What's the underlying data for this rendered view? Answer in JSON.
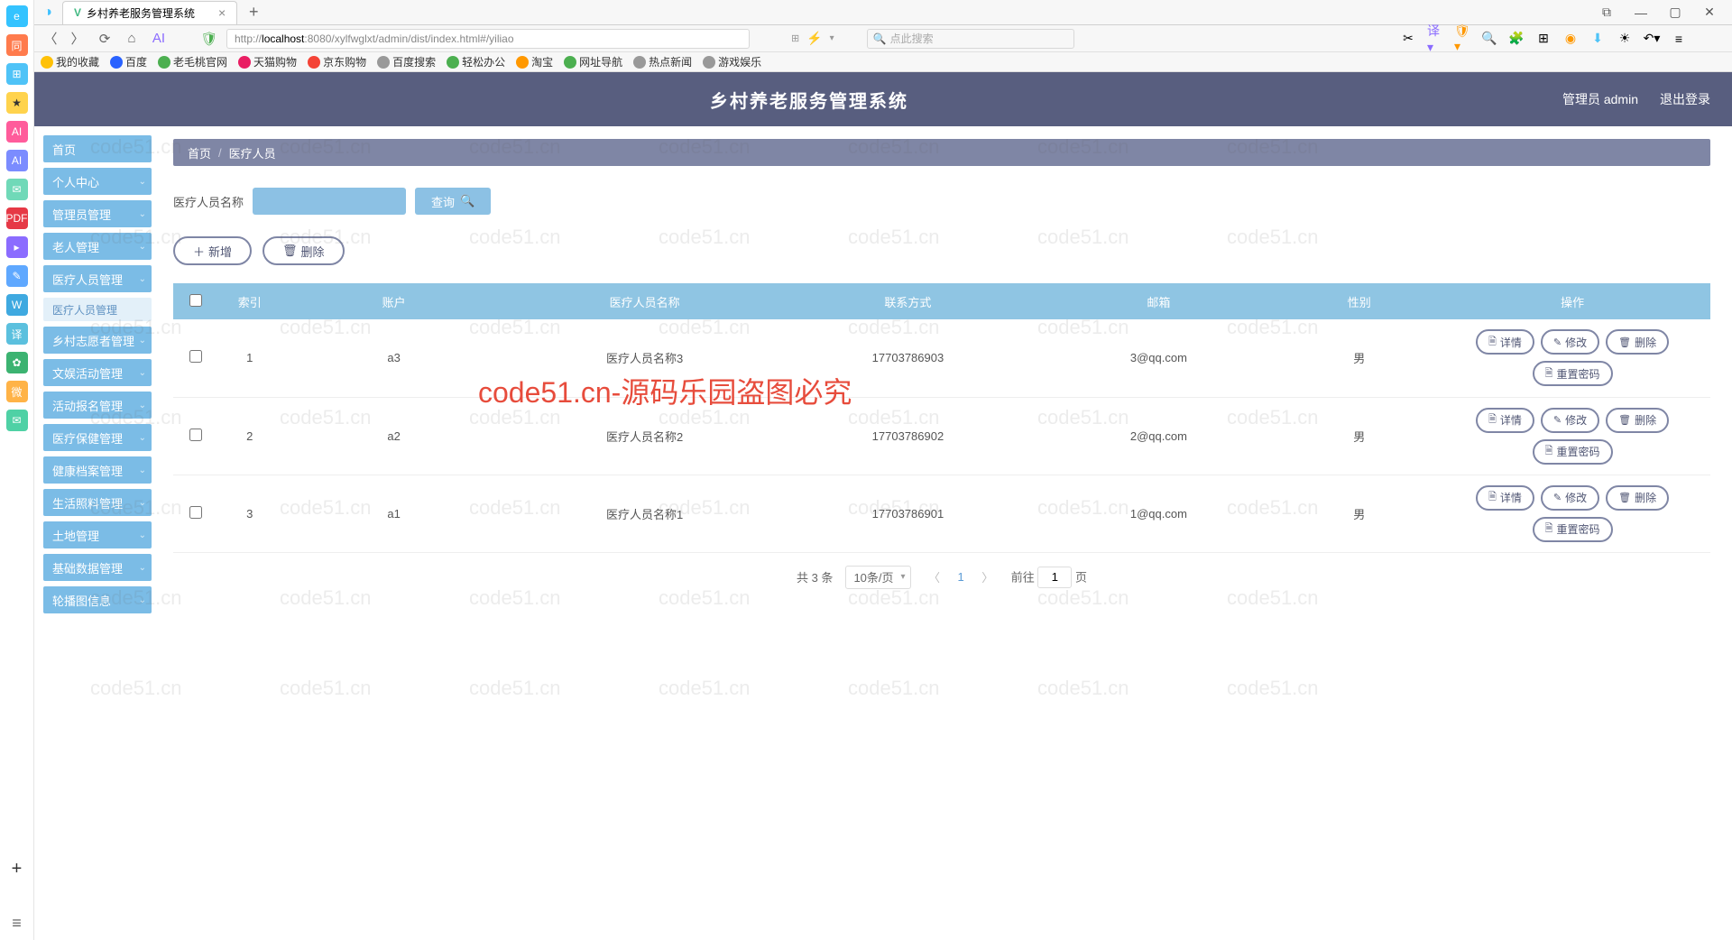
{
  "browser": {
    "tab_title": "乡村养老服务管理系统",
    "url_host": "localhost",
    "url_prefix": "http://",
    "url_port_path": ":8080/xylfwglxt/admin/dist/index.html#/yiliao",
    "search_placeholder": "点此搜索"
  },
  "bookmarks": [
    "我的收藏",
    "百度",
    "老毛桃官网",
    "天猫购物",
    "京东购物",
    "百度搜索",
    "轻松办公",
    "淘宝",
    "网址导航",
    "热点新闻",
    "游戏娱乐"
  ],
  "header": {
    "title": "乡村养老服务管理系统",
    "user_label": "管理员 admin",
    "logout": "退出登录"
  },
  "sidebar": {
    "items": [
      "首页",
      "个人中心",
      "管理员管理",
      "老人管理",
      "医疗人员管理",
      "医疗人员管理",
      "乡村志愿者管理",
      "文娱活动管理",
      "活动报名管理",
      "医疗保健管理",
      "健康档案管理",
      "生活照料管理",
      "土地管理",
      "基础数据管理",
      "轮播图信息"
    ]
  },
  "breadcrumb": {
    "home": "首页",
    "current": "医疗人员"
  },
  "search": {
    "label": "医疗人员名称",
    "btn": "查询"
  },
  "actions": {
    "add": "新增",
    "del": "删除"
  },
  "table": {
    "cols": [
      "",
      "索引",
      "账户",
      "医疗人员名称",
      "联系方式",
      "邮箱",
      "性别",
      "操作"
    ],
    "rows": [
      {
        "idx": "1",
        "acct": "a3",
        "name": "医疗人员名称3",
        "phone": "17703786903",
        "email": "3@qq.com",
        "gender": "男"
      },
      {
        "idx": "2",
        "acct": "a2",
        "name": "医疗人员名称2",
        "phone": "17703786902",
        "email": "2@qq.com",
        "gender": "男"
      },
      {
        "idx": "3",
        "acct": "a1",
        "name": "医疗人员名称1",
        "phone": "17703786901",
        "email": "1@qq.com",
        "gender": "男"
      }
    ],
    "ops": {
      "detail": "详情",
      "edit": "修改",
      "del": "删除",
      "reset": "重置密码"
    }
  },
  "pagination": {
    "total_label": "共 3 条",
    "page_size": "10条/页",
    "current": "1",
    "goto_prefix": "前往",
    "goto_suffix": "页",
    "goto_value": "1"
  },
  "watermark": "code51.cn",
  "watermark_red": "code51.cn-源码乐园盗图必究"
}
